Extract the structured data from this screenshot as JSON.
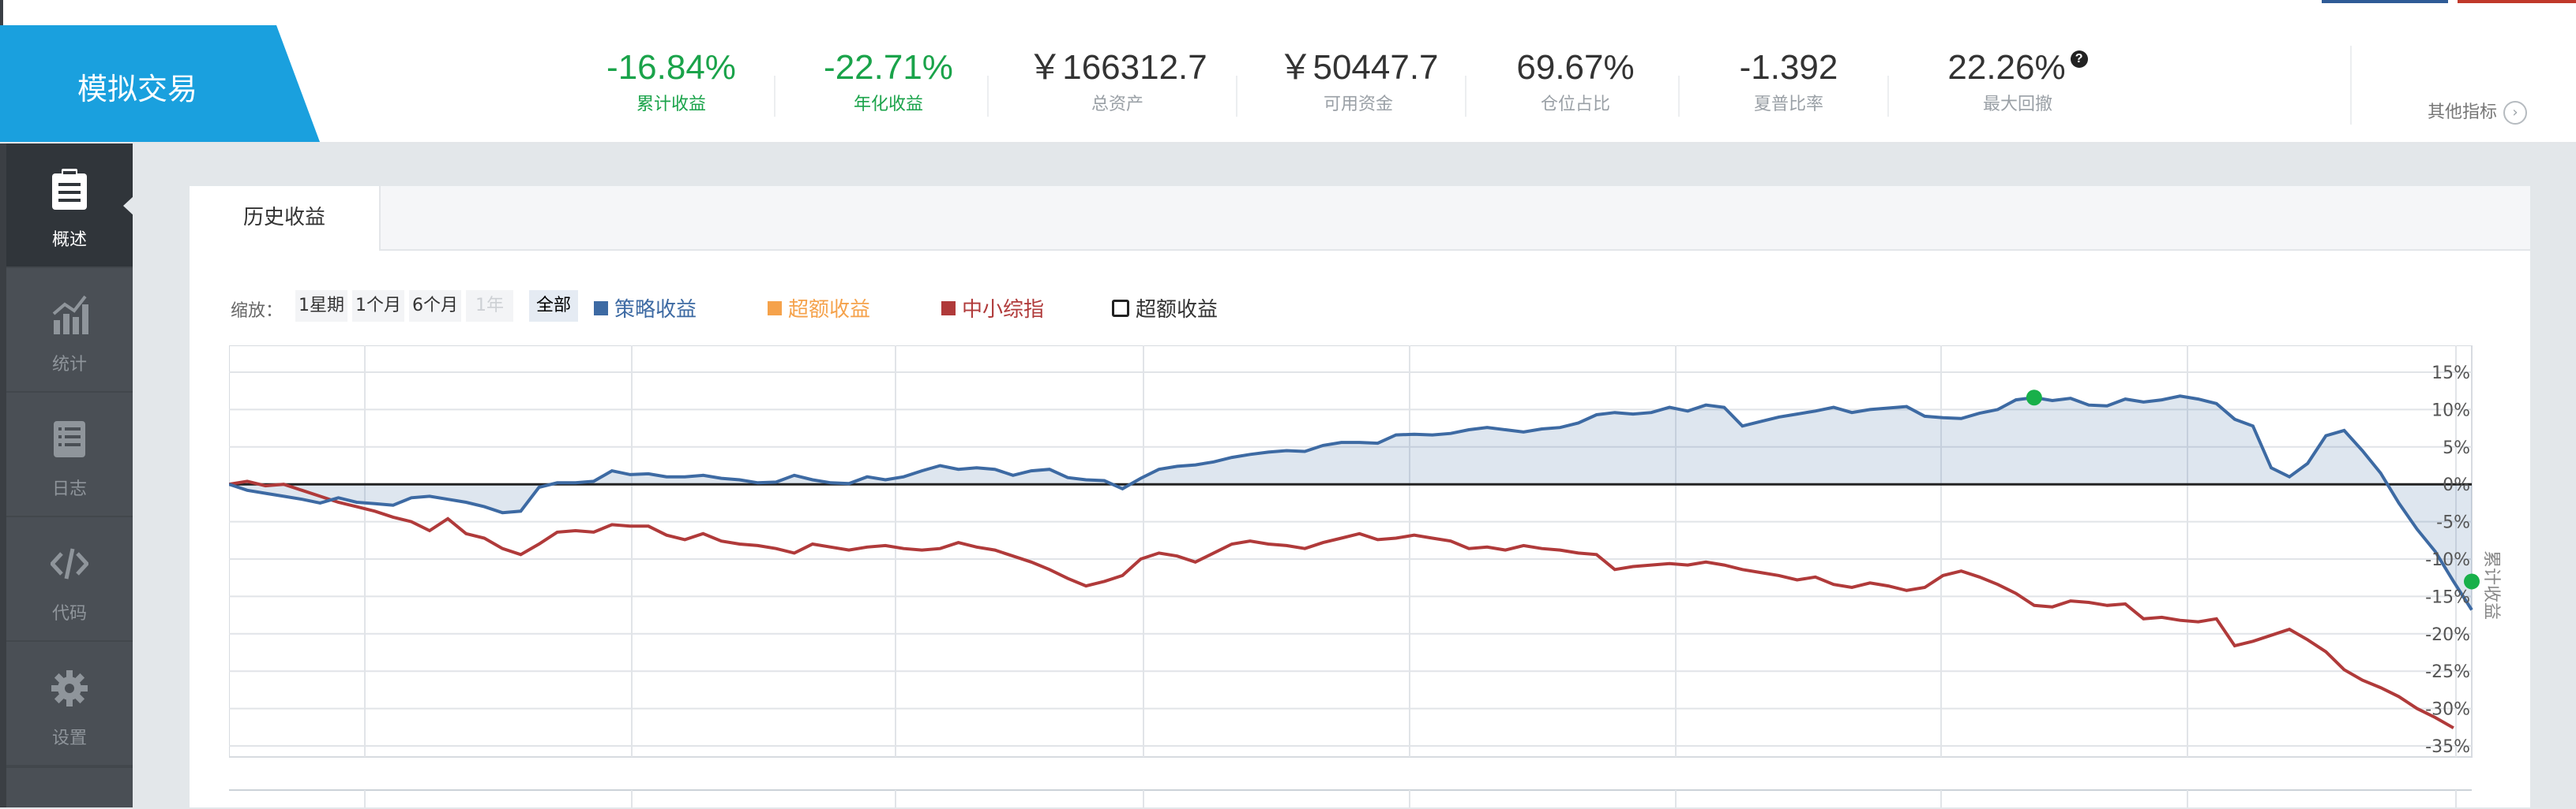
{
  "brand": {
    "title": "模拟交易"
  },
  "metrics": [
    {
      "value": "-16.84%",
      "label": "累计收益",
      "color": "green"
    },
    {
      "value": "-22.71%",
      "label": "年化收益",
      "color": "green"
    },
    {
      "value": "￥166312.7",
      "label": "总资产",
      "color": "default"
    },
    {
      "value": "￥50447.7",
      "label": "可用资金",
      "color": "default"
    },
    {
      "value": "69.67%",
      "label": "仓位占比",
      "color": "default"
    },
    {
      "value": "-1.392",
      "label": "夏普比率",
      "color": "default"
    },
    {
      "value": "22.26%",
      "label": "最大回撤",
      "color": "default"
    }
  ],
  "other_metrics": {
    "label": "其他指标",
    "icon": "chevron-right-circle-icon"
  },
  "sidebar": {
    "items": [
      {
        "label": "概述",
        "icon": "clipboard-icon",
        "active": true
      },
      {
        "label": "统计",
        "icon": "bar-chart-icon",
        "active": false
      },
      {
        "label": "日志",
        "icon": "list-icon",
        "active": false
      },
      {
        "label": "代码",
        "icon": "code-icon",
        "active": false
      },
      {
        "label": "设置",
        "icon": "gear-icon",
        "active": false
      }
    ]
  },
  "tabs": {
    "active": "历史收益"
  },
  "toolbar": {
    "zoom_label": "缩放：",
    "zoom_options": [
      "1星期",
      "1个月",
      "6个月",
      "1年",
      "全部"
    ],
    "zoom_selected": "全部",
    "zoom_disabled": "1年"
  },
  "colors": {
    "strategy": "#3d6aa3",
    "excess": "#f5a24b",
    "benchmark": "#b03a3a",
    "excess_box": "#222222",
    "brand": "#1aa0de",
    "positive_marker": "#18b04a"
  },
  "chart_data": {
    "type": "line",
    "legend": [
      "策略收益",
      "超额收益",
      "中小综指",
      "超额收益"
    ],
    "y_axis_label": "累计收益",
    "y_ticks": [
      "15%",
      "10%",
      "5%",
      "0%",
      "-5%",
      "-10%",
      "-15%",
      "-20%",
      "-25%",
      "-30%",
      "-35%"
    ],
    "ylim": [
      -35,
      15
    ],
    "series": [
      {
        "name": "策略收益",
        "values": [
          0,
          -0.8,
          -1.2,
          -1.6,
          -2,
          -2.5,
          -1.8,
          -2.4,
          -2.6,
          -2.8,
          -1.8,
          -1.6,
          -2,
          -2.4,
          -3,
          -3.8,
          -3.6,
          -0.4,
          0.2,
          0.2,
          0.4,
          1.8,
          1.3,
          1.4,
          1,
          1,
          1.2,
          0.8,
          0.6,
          0.2,
          0.3,
          1.2,
          0.6,
          0.2,
          0.1,
          1,
          0.6,
          1,
          1.8,
          2.5,
          2,
          2.2,
          2,
          1.2,
          1.8,
          2,
          0.9,
          0.6,
          0.5,
          -0.6,
          0.8,
          2,
          2.4,
          2.6,
          3,
          3.6,
          4,
          4.3,
          4.5,
          4.4,
          5.2,
          5.6,
          5.6,
          5.5,
          6.6,
          6.7,
          6.6,
          6.8,
          7.3,
          7.6,
          7.3,
          7,
          7.4,
          7.6,
          8.2,
          9.3,
          9.6,
          9.4,
          9.6,
          10.3,
          9.8,
          10.6,
          10.3,
          7.8,
          8.4,
          9,
          9.4,
          9.8,
          10.3,
          9.6,
          10,
          10.2,
          10.4,
          9.1,
          8.9,
          8.8,
          9.5,
          10,
          11.3,
          11.6,
          11.2,
          11.5,
          10.6,
          10.5,
          11.4,
          11,
          11.3,
          11.8,
          11.4,
          10.8,
          8.7,
          7.8,
          2.2,
          1,
          2.8,
          6.5,
          7.2,
          4.5,
          1.5,
          -2.5,
          -6,
          -9,
          -13,
          -16.8
        ],
        "markers": [
          {
            "index": 99,
            "value": 11.6
          },
          {
            "index": 123,
            "value": -13
          }
        ]
      },
      {
        "name": "中小综指",
        "values": [
          0,
          0.4,
          -0.2,
          0,
          -0.8,
          -1.6,
          -2.4,
          -3,
          -3.6,
          -4.4,
          -5,
          -6.2,
          -4.6,
          -6.6,
          -7.2,
          -8.6,
          -9.4,
          -8,
          -6.4,
          -6.2,
          -6.4,
          -5.4,
          -5.6,
          -5.6,
          -6.8,
          -7.4,
          -6.6,
          -7.6,
          -8,
          -8.2,
          -8.6,
          -9.2,
          -8,
          -8.4,
          -8.8,
          -8.4,
          -8.2,
          -8.6,
          -8.8,
          -8.6,
          -7.8,
          -8.4,
          -8.8,
          -9.6,
          -10.4,
          -11.4,
          -12.6,
          -13.6,
          -13,
          -12.2,
          -10,
          -9.2,
          -9.6,
          -10.4,
          -9.2,
          -8,
          -7.6,
          -8,
          -8.2,
          -8.6,
          -7.8,
          -7.2,
          -6.6,
          -7.4,
          -7.2,
          -6.8,
          -7.2,
          -7.6,
          -8.6,
          -8.4,
          -8.8,
          -8.2,
          -8.6,
          -8.8,
          -9.2,
          -9.4,
          -11.4,
          -11,
          -10.8,
          -10.6,
          -10.8,
          -10.4,
          -10.8,
          -11.4,
          -11.8,
          -12.2,
          -12.8,
          -12.4,
          -13.4,
          -13.8,
          -13.2,
          -13.6,
          -14.2,
          -13.8,
          -12.2,
          -11.6,
          -12.4,
          -13.4,
          -14.6,
          -16.2,
          -16.4,
          -15.6,
          -15.8,
          -16.2,
          -16,
          -18,
          -17.8,
          -18.2,
          -18.4,
          -18,
          -21.6,
          -21,
          -20.2,
          -19.4,
          -20.8,
          -22.4,
          -24.8,
          -26.2,
          -27.2,
          -28.4,
          -30,
          -31.2,
          -32.6
        ]
      }
    ]
  }
}
